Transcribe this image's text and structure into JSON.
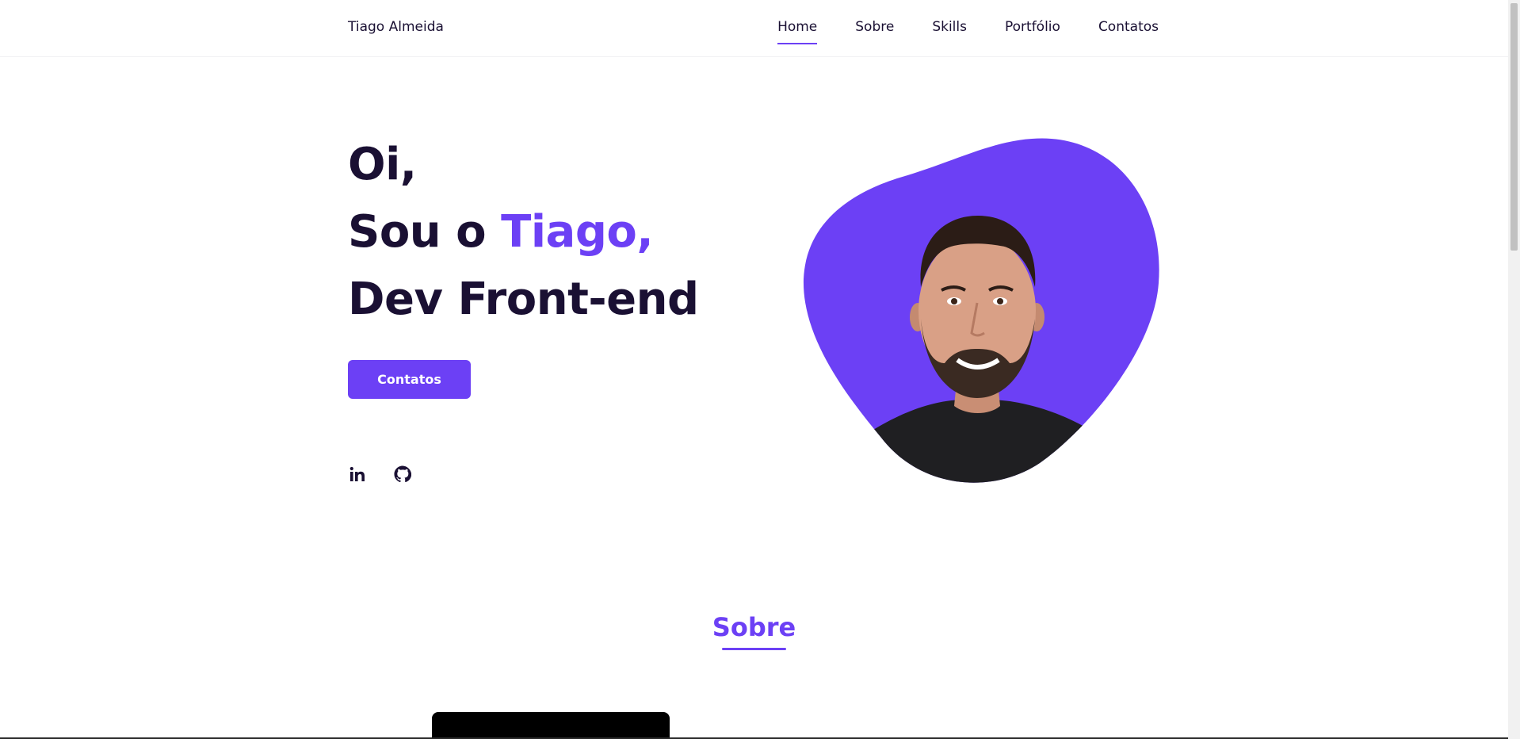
{
  "header": {
    "brand": "Tiago Almeida",
    "nav": [
      {
        "label": "Home",
        "active": true
      },
      {
        "label": "Sobre",
        "active": false
      },
      {
        "label": "Skills",
        "active": false
      },
      {
        "label": "Portfólio",
        "active": false
      },
      {
        "label": "Contatos",
        "active": false
      }
    ]
  },
  "hero": {
    "line1": "Oi,",
    "line2_prefix": "Sou o ",
    "line2_name": "Tiago,",
    "line3": "Dev Front-end",
    "cta_label": "Contatos",
    "social": [
      {
        "icon": "linkedin-icon"
      },
      {
        "icon": "github-icon"
      }
    ]
  },
  "about": {
    "title": "Sobre"
  },
  "colors": {
    "accent": "#6c40f5",
    "text_dark": "#1a1033",
    "background": "#ffffff"
  }
}
